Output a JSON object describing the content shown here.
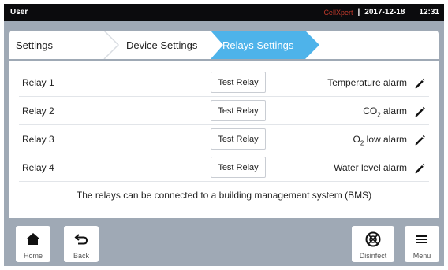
{
  "status": {
    "user": "User",
    "brand": "CellXpert",
    "separator": "|",
    "date": "2017-12-18",
    "time": "12:31"
  },
  "breadcrumb": [
    "Settings",
    "Device Settings",
    "Relays Settings"
  ],
  "colors": {
    "accent": "#4eb3ea",
    "background": "#9fa9b5",
    "statusbar": "#0b0b0d"
  },
  "relays": [
    {
      "label": "Relay 1",
      "test": "Test Relay",
      "alarm": "Temperature alarm"
    },
    {
      "label": "Relay 2",
      "test": "Test Relay",
      "alarm_main": "CO",
      "alarm_sub": "2",
      "alarm_rest": " alarm"
    },
    {
      "label": "Relay 3",
      "test": "Test Relay",
      "alarm_main": "O",
      "alarm_sub": "2",
      "alarm_rest": " low alarm"
    },
    {
      "label": "Relay 4",
      "test": "Test Relay",
      "alarm": "Water level alarm"
    }
  ],
  "note": "The relays can be connected to a building management system (BMS)",
  "footer": {
    "home": "Home",
    "back": "Back",
    "disinfect": "Disinfect",
    "menu": "Menu"
  },
  "icons": {
    "home": "home-icon",
    "back": "back-arrow-icon",
    "disinfect": "disinfect-icon",
    "menu": "menu-icon",
    "edit": "pencil-icon"
  }
}
